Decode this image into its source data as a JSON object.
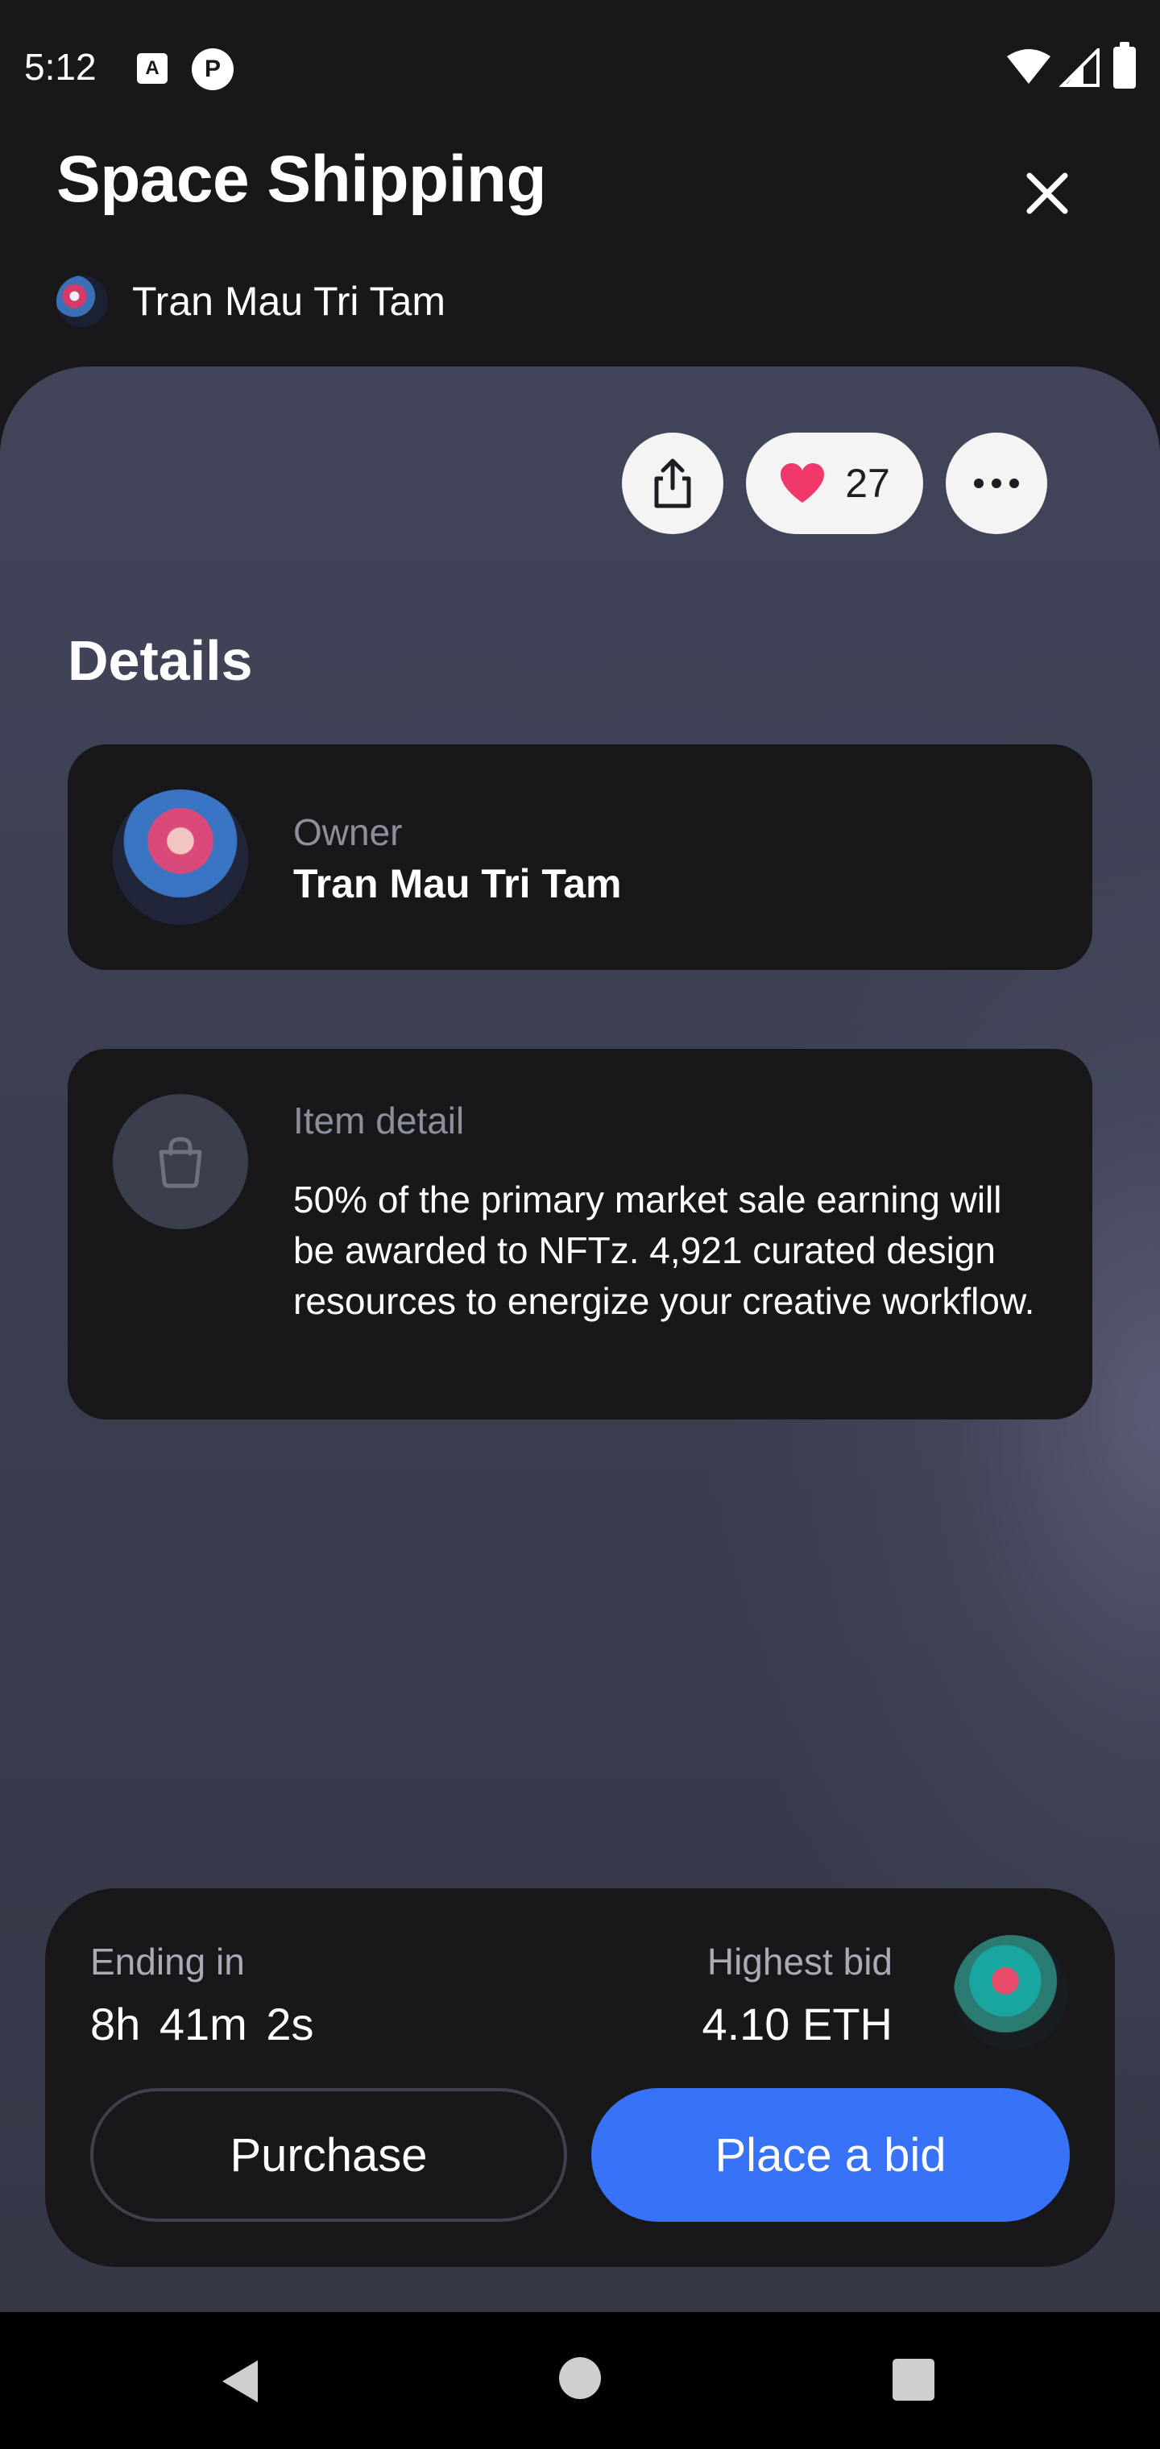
{
  "status_bar": {
    "time": "5:12",
    "icons": [
      "a-badge-icon",
      "p-badge-icon",
      "wifi-icon",
      "signal-icon",
      "battery-icon"
    ],
    "badge_a": "A",
    "badge_b": "P"
  },
  "header": {
    "title": "Space Shipping",
    "close_icon": "close-icon",
    "author": "Tran Mau Tri Tam"
  },
  "actions": {
    "share_icon": "share-icon",
    "like_icon": "heart-icon",
    "like_count": "27",
    "more_icon": "more-icon"
  },
  "details": {
    "title": "Details",
    "owner_label": "Owner",
    "owner_name": "Tran Mau Tri Tam",
    "item_label": "Item detail",
    "item_text": "50% of the primary market sale earning will be awarded to NFTz. 4,921 curated design resources to energize your creative workflow."
  },
  "auction": {
    "ending_label": "Ending in",
    "ending_value": "8h 41m 2s",
    "bid_label": "Highest bid",
    "bid_value": "4.10 ETH",
    "purchase_label": "Purchase",
    "bid_button_label": "Place a bid"
  },
  "colors": {
    "accent": "#3872f7",
    "heart": "#f0386b",
    "card": "#18181b",
    "panel": "#3c3f51"
  }
}
